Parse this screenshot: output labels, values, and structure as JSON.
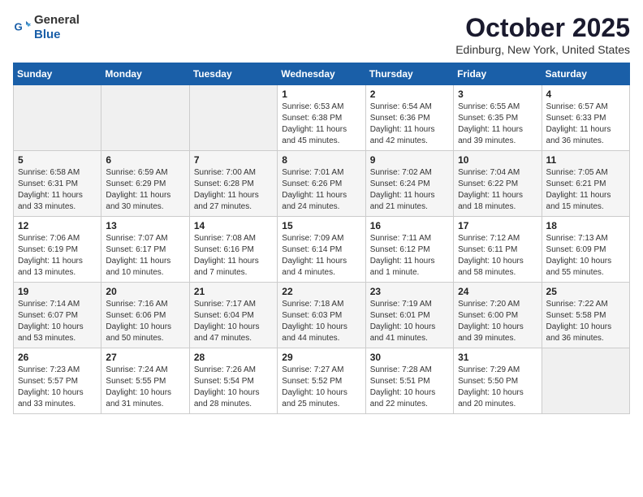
{
  "logo": {
    "general": "General",
    "blue": "Blue"
  },
  "header": {
    "month": "October 2025",
    "location": "Edinburg, New York, United States"
  },
  "weekdays": [
    "Sunday",
    "Monday",
    "Tuesday",
    "Wednesday",
    "Thursday",
    "Friday",
    "Saturday"
  ],
  "weeks": [
    [
      {
        "day": "",
        "info": ""
      },
      {
        "day": "",
        "info": ""
      },
      {
        "day": "",
        "info": ""
      },
      {
        "day": "1",
        "info": "Sunrise: 6:53 AM\nSunset: 6:38 PM\nDaylight: 11 hours\nand 45 minutes."
      },
      {
        "day": "2",
        "info": "Sunrise: 6:54 AM\nSunset: 6:36 PM\nDaylight: 11 hours\nand 42 minutes."
      },
      {
        "day": "3",
        "info": "Sunrise: 6:55 AM\nSunset: 6:35 PM\nDaylight: 11 hours\nand 39 minutes."
      },
      {
        "day": "4",
        "info": "Sunrise: 6:57 AM\nSunset: 6:33 PM\nDaylight: 11 hours\nand 36 minutes."
      }
    ],
    [
      {
        "day": "5",
        "info": "Sunrise: 6:58 AM\nSunset: 6:31 PM\nDaylight: 11 hours\nand 33 minutes."
      },
      {
        "day": "6",
        "info": "Sunrise: 6:59 AM\nSunset: 6:29 PM\nDaylight: 11 hours\nand 30 minutes."
      },
      {
        "day": "7",
        "info": "Sunrise: 7:00 AM\nSunset: 6:28 PM\nDaylight: 11 hours\nand 27 minutes."
      },
      {
        "day": "8",
        "info": "Sunrise: 7:01 AM\nSunset: 6:26 PM\nDaylight: 11 hours\nand 24 minutes."
      },
      {
        "day": "9",
        "info": "Sunrise: 7:02 AM\nSunset: 6:24 PM\nDaylight: 11 hours\nand 21 minutes."
      },
      {
        "day": "10",
        "info": "Sunrise: 7:04 AM\nSunset: 6:22 PM\nDaylight: 11 hours\nand 18 minutes."
      },
      {
        "day": "11",
        "info": "Sunrise: 7:05 AM\nSunset: 6:21 PM\nDaylight: 11 hours\nand 15 minutes."
      }
    ],
    [
      {
        "day": "12",
        "info": "Sunrise: 7:06 AM\nSunset: 6:19 PM\nDaylight: 11 hours\nand 13 minutes."
      },
      {
        "day": "13",
        "info": "Sunrise: 7:07 AM\nSunset: 6:17 PM\nDaylight: 11 hours\nand 10 minutes."
      },
      {
        "day": "14",
        "info": "Sunrise: 7:08 AM\nSunset: 6:16 PM\nDaylight: 11 hours\nand 7 minutes."
      },
      {
        "day": "15",
        "info": "Sunrise: 7:09 AM\nSunset: 6:14 PM\nDaylight: 11 hours\nand 4 minutes."
      },
      {
        "day": "16",
        "info": "Sunrise: 7:11 AM\nSunset: 6:12 PM\nDaylight: 11 hours\nand 1 minute."
      },
      {
        "day": "17",
        "info": "Sunrise: 7:12 AM\nSunset: 6:11 PM\nDaylight: 10 hours\nand 58 minutes."
      },
      {
        "day": "18",
        "info": "Sunrise: 7:13 AM\nSunset: 6:09 PM\nDaylight: 10 hours\nand 55 minutes."
      }
    ],
    [
      {
        "day": "19",
        "info": "Sunrise: 7:14 AM\nSunset: 6:07 PM\nDaylight: 10 hours\nand 53 minutes."
      },
      {
        "day": "20",
        "info": "Sunrise: 7:16 AM\nSunset: 6:06 PM\nDaylight: 10 hours\nand 50 minutes."
      },
      {
        "day": "21",
        "info": "Sunrise: 7:17 AM\nSunset: 6:04 PM\nDaylight: 10 hours\nand 47 minutes."
      },
      {
        "day": "22",
        "info": "Sunrise: 7:18 AM\nSunset: 6:03 PM\nDaylight: 10 hours\nand 44 minutes."
      },
      {
        "day": "23",
        "info": "Sunrise: 7:19 AM\nSunset: 6:01 PM\nDaylight: 10 hours\nand 41 minutes."
      },
      {
        "day": "24",
        "info": "Sunrise: 7:20 AM\nSunset: 6:00 PM\nDaylight: 10 hours\nand 39 minutes."
      },
      {
        "day": "25",
        "info": "Sunrise: 7:22 AM\nSunset: 5:58 PM\nDaylight: 10 hours\nand 36 minutes."
      }
    ],
    [
      {
        "day": "26",
        "info": "Sunrise: 7:23 AM\nSunset: 5:57 PM\nDaylight: 10 hours\nand 33 minutes."
      },
      {
        "day": "27",
        "info": "Sunrise: 7:24 AM\nSunset: 5:55 PM\nDaylight: 10 hours\nand 31 minutes."
      },
      {
        "day": "28",
        "info": "Sunrise: 7:26 AM\nSunset: 5:54 PM\nDaylight: 10 hours\nand 28 minutes."
      },
      {
        "day": "29",
        "info": "Sunrise: 7:27 AM\nSunset: 5:52 PM\nDaylight: 10 hours\nand 25 minutes."
      },
      {
        "day": "30",
        "info": "Sunrise: 7:28 AM\nSunset: 5:51 PM\nDaylight: 10 hours\nand 22 minutes."
      },
      {
        "day": "31",
        "info": "Sunrise: 7:29 AM\nSunset: 5:50 PM\nDaylight: 10 hours\nand 20 minutes."
      },
      {
        "day": "",
        "info": ""
      }
    ]
  ]
}
